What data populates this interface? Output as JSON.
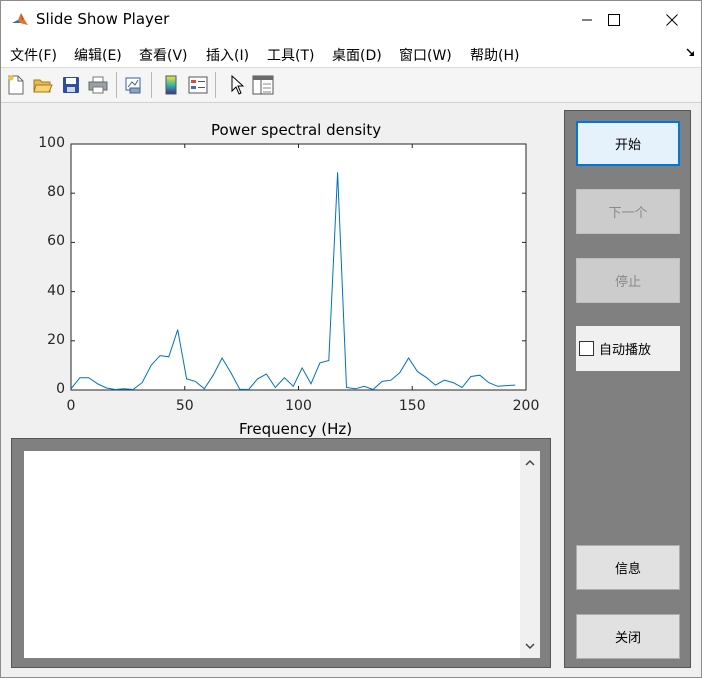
{
  "window": {
    "title": "Slide Show Player"
  },
  "menu": {
    "items": [
      "文件(F)",
      "编辑(E)",
      "查看(V)",
      "插入(I)",
      "工具(T)",
      "桌面(D)",
      "窗口(W)",
      "帮助(H)"
    ]
  },
  "toolbar": {
    "icons": [
      "new-file-icon",
      "open-folder-icon",
      "save-icon",
      "print-icon",
      "link-plot-icon",
      "colorbar-icon",
      "legend-icon",
      "pointer-icon",
      "property-editor-icon"
    ]
  },
  "chart_data": {
    "type": "line",
    "title": "Power spectral density",
    "xlabel": "Frequency (Hz)",
    "ylabel": "",
    "xlim": [
      0,
      200
    ],
    "ylim": [
      0,
      100
    ],
    "xticks": [
      0,
      50,
      100,
      150,
      200
    ],
    "yticks": [
      0,
      20,
      40,
      60,
      80,
      100
    ],
    "grid": false,
    "series": [
      {
        "color": "#0072bd",
        "x": [
          0,
          3.9,
          7.8,
          11.7,
          15.6,
          19.5,
          23.4,
          27.3,
          31.3,
          35.2,
          39.1,
          43,
          46.9,
          50.8,
          54.7,
          58.6,
          62.5,
          66.4,
          70.3,
          74.2,
          78.1,
          82,
          85.9,
          89.8,
          93.8,
          97.7,
          101.6,
          105.5,
          109.4,
          113.3,
          117.2,
          121.1,
          125,
          128.9,
          132.8,
          136.7,
          140.6,
          144.5,
          148.4,
          152.3,
          156.3,
          160.2,
          164.1,
          168,
          171.9,
          175.8,
          179.7,
          183.6,
          187.5,
          191.4,
          195.3
        ],
        "y": [
          0.5,
          5,
          5,
          2.5,
          0.8,
          0.2,
          0.5,
          0.2,
          3,
          10,
          14,
          13.5,
          24.5,
          4.5,
          3.5,
          0.5,
          6,
          13,
          7,
          0.3,
          0.2,
          4.5,
          6.5,
          1,
          5,
          1.5,
          9,
          2.5,
          11,
          12,
          88.5,
          1,
          0.5,
          1.5,
          0.2,
          3.5,
          4,
          7,
          13,
          7.5,
          5,
          2,
          4,
          3,
          1,
          5.5,
          6,
          3,
          1.5,
          1.8,
          2
        ]
      }
    ]
  },
  "text_panel": {
    "content": ""
  },
  "side_panel": {
    "start_label": "开始",
    "next_label": "下一个",
    "stop_label": "停止",
    "autoplay_label": "自动播放",
    "autoplay_checked": false,
    "info_label": "信息",
    "close_label": "关闭"
  }
}
